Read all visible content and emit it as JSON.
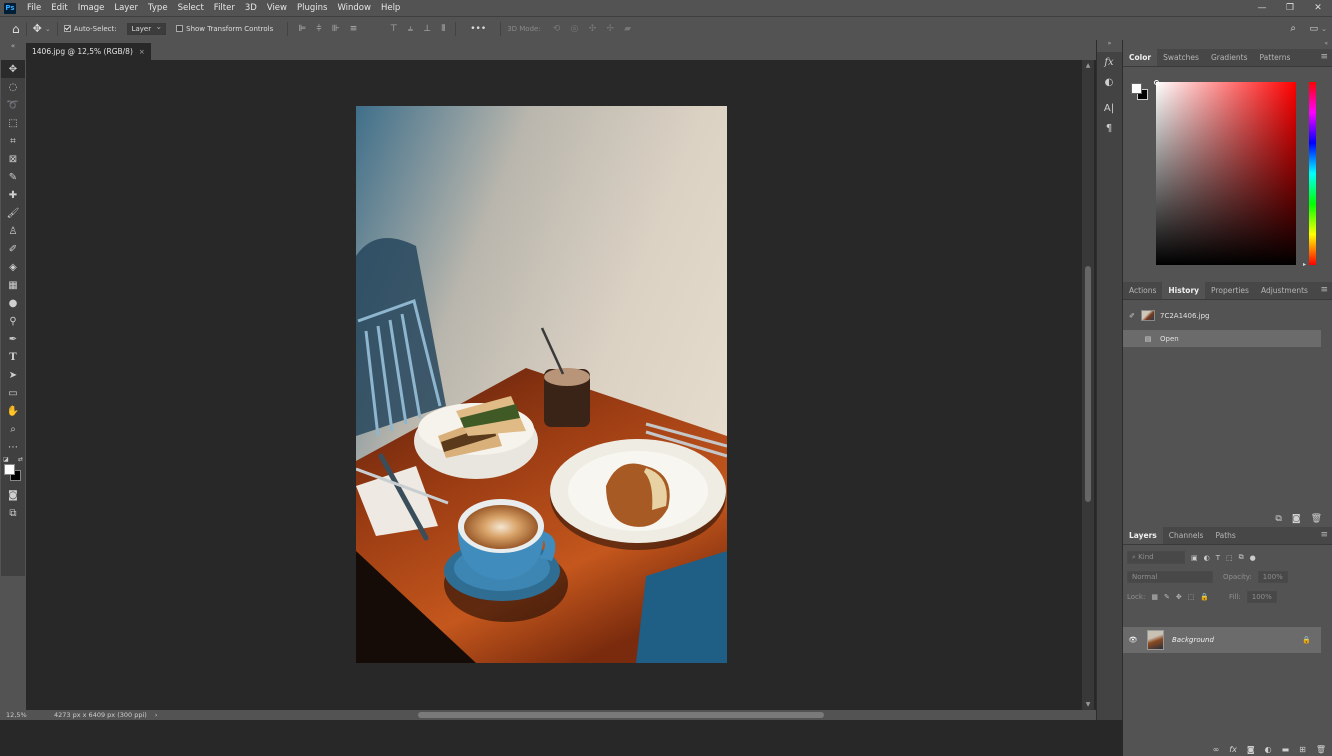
{
  "app": {
    "logo": "Ps"
  },
  "menu": [
    "File",
    "Edit",
    "Image",
    "Layer",
    "Type",
    "Select",
    "Filter",
    "3D",
    "View",
    "Plugins",
    "Window",
    "Help"
  ],
  "window_controls": {
    "minimize": "—",
    "maximize": "❐",
    "close": "✕"
  },
  "options_bar": {
    "auto_select_label": "Auto-Select:",
    "auto_select_checked": true,
    "auto_select_target": "Layer",
    "transform_controls_label": "Show Transform Controls",
    "transform_controls_checked": false,
    "more_label": "•••",
    "mode_3d_label": "3D Mode:"
  },
  "document": {
    "tab_title": "1406.jpg @ 12,5% (RGB/8)",
    "tab_close": "×"
  },
  "status": {
    "zoom": "12,5%",
    "dimensions": "4273 px x 6409 px (300 ppi)",
    "arrow": "›"
  },
  "color_panel": {
    "tabs": [
      "Color",
      "Swatches",
      "Gradients",
      "Patterns"
    ],
    "active_tab": "Color"
  },
  "history_panel": {
    "tabs": [
      "Actions",
      "History",
      "Properties",
      "Adjustments"
    ],
    "active_tab": "History",
    "snapshot_name": "7C2A1406.jpg",
    "states": [
      "Open"
    ]
  },
  "layers_panel": {
    "tabs": [
      "Layers",
      "Channels",
      "Paths"
    ],
    "active_tab": "Layers",
    "filter_label": "Kind",
    "blend_mode": "Normal",
    "opacity_label": "Opacity:",
    "opacity_value": "100%",
    "lock_label": "Lock:",
    "fill_label": "Fill:",
    "fill_value": "100%",
    "layers": [
      {
        "name": "Background",
        "visible": true,
        "locked": true
      }
    ]
  },
  "colors": {
    "foreground": "#ffffff",
    "background": "#000000",
    "ui_dark": "#282828",
    "ui_panel": "#535353"
  }
}
